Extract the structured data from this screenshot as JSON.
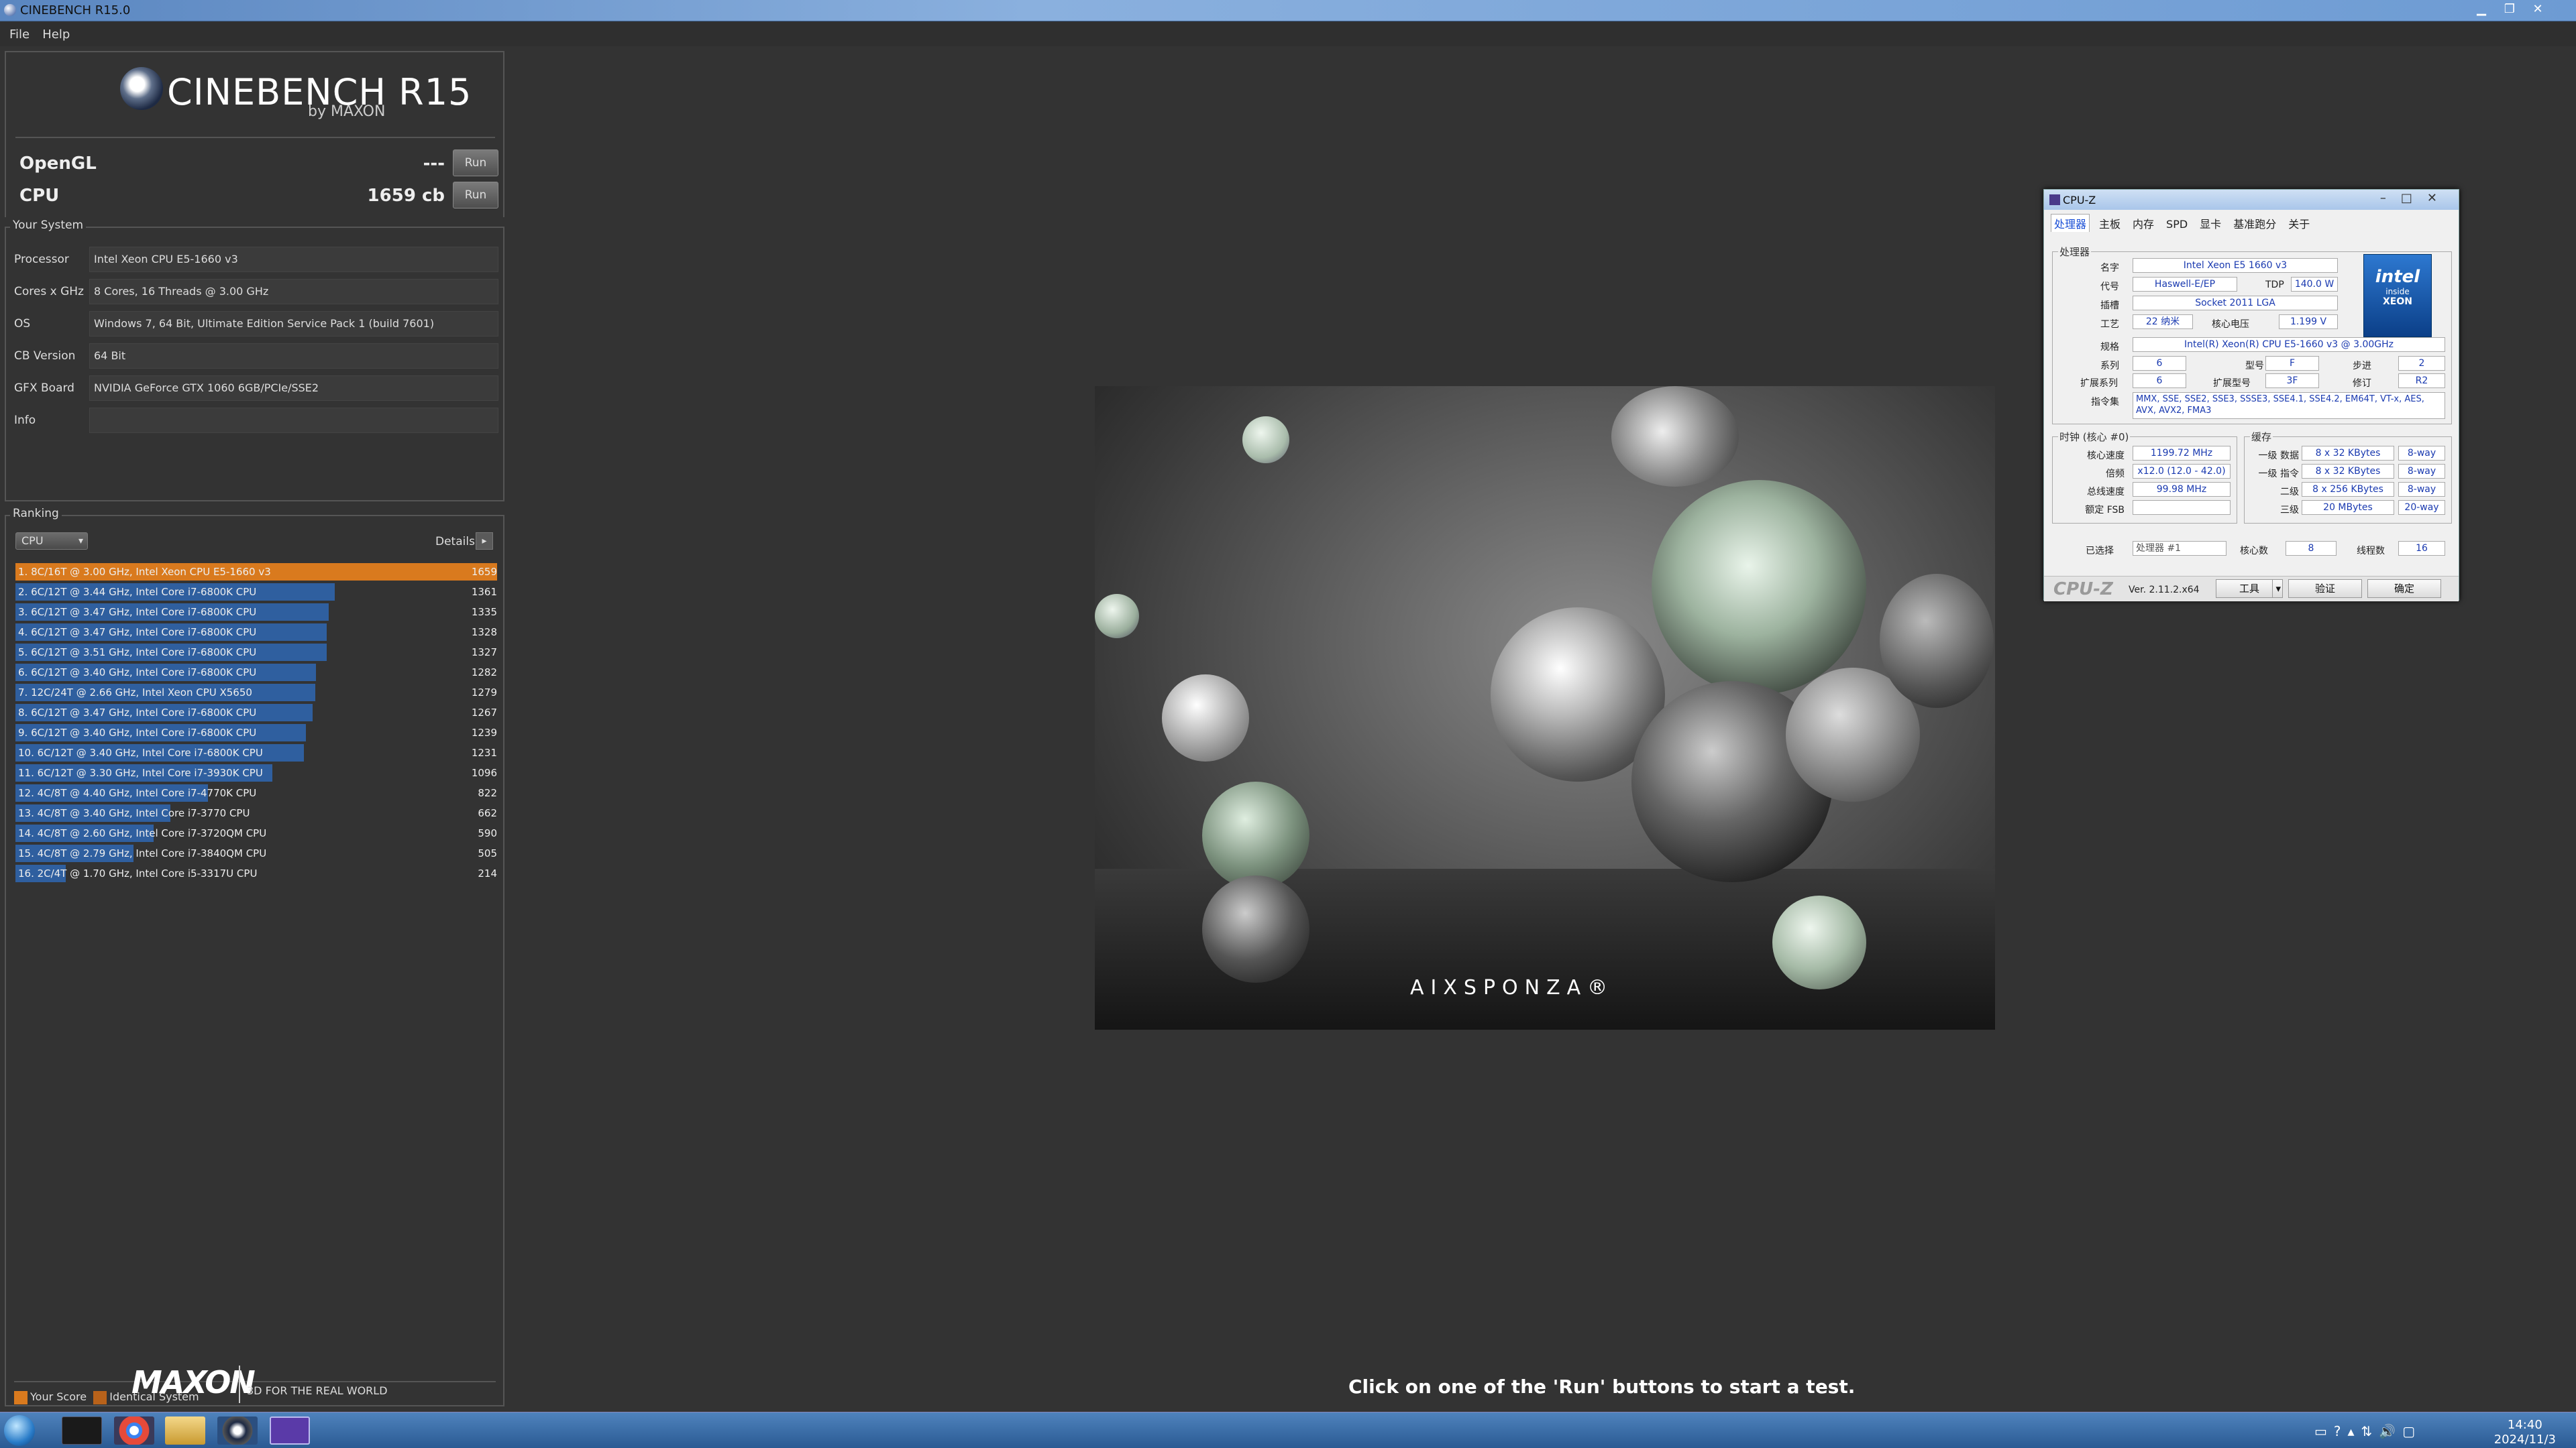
{
  "window": {
    "title": "CINEBENCH R15.0"
  },
  "menu": [
    "File",
    "Help"
  ],
  "logo": {
    "name": "CINEBENCH R15",
    "by": "by MAXON"
  },
  "tests": [
    {
      "label": "OpenGL",
      "value": "---",
      "run": "Run"
    },
    {
      "label": "CPU",
      "value": "1659 cb",
      "run": "Run"
    }
  ],
  "your_system": {
    "title": "Your System",
    "rows": [
      {
        "k": "Processor",
        "v": "Intel Xeon CPU E5-1660 v3"
      },
      {
        "k": "Cores x GHz",
        "v": "8 Cores, 16 Threads @ 3.00 GHz"
      },
      {
        "k": "OS",
        "v": "Windows 7, 64 Bit, Ultimate Edition Service Pack 1 (build 7601)"
      },
      {
        "k": "CB Version",
        "v": "64 Bit"
      },
      {
        "k": "GFX Board",
        "v": "NVIDIA GeForce GTX 1060 6GB/PCIe/SSE2"
      },
      {
        "k": "Info",
        "v": ""
      }
    ]
  },
  "ranking": {
    "title": "Ranking",
    "dropdown": "CPU",
    "details": "Details",
    "details_arrow": "▸",
    "rows": [
      {
        "t": "1. 8C/16T @ 3.00 GHz, Intel Xeon CPU E5-1660 v3",
        "s": "1659",
        "frac": 1.0,
        "mine": true
      },
      {
        "t": "2. 6C/12T @ 3.44 GHz, Intel Core i7-6800K CPU",
        "s": "1361",
        "frac": 0.82
      },
      {
        "t": "3. 6C/12T @ 3.47 GHz, Intel Core i7-6800K CPU",
        "s": "1335",
        "frac": 0.805
      },
      {
        "t": "4. 6C/12T @ 3.47 GHz, Intel Core i7-6800K CPU",
        "s": "1328",
        "frac": 0.8
      },
      {
        "t": "5. 6C/12T @ 3.51 GHz, Intel Core i7-6800K CPU",
        "s": "1327",
        "frac": 0.8
      },
      {
        "t": "6. 6C/12T @ 3.40 GHz, Intel Core i7-6800K CPU",
        "s": "1282",
        "frac": 0.773
      },
      {
        "t": "7. 12C/24T @ 2.66 GHz, Intel Xeon CPU X5650",
        "s": "1279",
        "frac": 0.771
      },
      {
        "t": "8. 6C/12T @ 3.47 GHz, Intel Core i7-6800K CPU",
        "s": "1267",
        "frac": 0.764
      },
      {
        "t": "9. 6C/12T @ 3.40 GHz, Intel Core i7-6800K CPU",
        "s": "1239",
        "frac": 0.747
      },
      {
        "t": "10. 6C/12T @ 3.40 GHz, Intel Core i7-6800K CPU",
        "s": "1231",
        "frac": 0.742
      },
      {
        "t": "11. 6C/12T @ 3.30 GHz,  Intel Core i7-3930K CPU",
        "s": "1096",
        "frac": 0.661
      },
      {
        "t": "12. 4C/8T @ 4.40 GHz, Intel Core i7-4770K CPU",
        "s": "822",
        "frac": 0.495
      },
      {
        "t": "13. 4C/8T @ 3.40 GHz,  Intel Core i7-3770 CPU",
        "s": "662",
        "frac": 0.399
      },
      {
        "t": "14. 4C/8T @ 2.60 GHz, Intel Core i7-3720QM CPU",
        "s": "590",
        "frac": 0.356
      },
      {
        "t": "15. 4C/8T @ 2.79 GHz,  Intel Core i7-3840QM CPU",
        "s": "505",
        "frac": 0.304
      },
      {
        "t": "16. 2C/4T @ 1.70 GHz,  Intel Core i5-3317U CPU",
        "s": "214",
        "frac": 0.129
      }
    ],
    "legend": {
      "yours": "Your Score",
      "identical": "Identical System",
      "yours_color": "#d97a1e",
      "identical_color": "#b8621a"
    }
  },
  "footer": {
    "maxon": "MAXON",
    "tagline": "3D FOR THE REAL WORLD",
    "hint": "Click on one of the 'Run' buttons to start a test."
  },
  "render": {
    "watermark": "AIXSPONZA®"
  },
  "cpuz": {
    "title": "CPU-Z",
    "tabs": [
      "处理器",
      "主板",
      "内存",
      "SPD",
      "显卡",
      "基准跑分",
      "关于"
    ],
    "proc_group": "处理器",
    "labels": {
      "name": "名字",
      "code": "代号",
      "tdp": "TDP",
      "pkg": "插槽",
      "tech": "工艺",
      "vcore": "核心电压",
      "spec": "规格",
      "family": "系列",
      "model": "型号",
      "stepping": "步进",
      "extfam": "扩展系列",
      "extmodel": "扩展型号",
      "rev": "修订",
      "instr": "指令集"
    },
    "name": "Intel Xeon E5 1660 v3",
    "code": "Haswell-E/EP",
    "tdp": "140.0 W",
    "pkg": "Socket 2011 LGA",
    "tech": "22 纳米",
    "vcore": "1.199 V",
    "spec": "Intel(R) Xeon(R) CPU E5-1660 v3 @ 3.00GHz",
    "family": "6",
    "model": "F",
    "stepping": "2",
    "extfam": "6",
    "extmodel": "3F",
    "rev": "R2",
    "instr": "MMX, SSE, SSE2, SSE3, SSSE3, SSE4.1, SSE4.2, EM64T, VT-x, AES, AVX, AVX2, FMA3",
    "intel": {
      "a": "intel",
      "b": "inside",
      "c": "XEON"
    },
    "clock_group": "时钟 (核心 #0)",
    "cache_group": "缓存",
    "clock": [
      {
        "k": "核心速度",
        "v": "1199.72 MHz"
      },
      {
        "k": "倍频",
        "v": "x12.0 (12.0 - 42.0)"
      },
      {
        "k": "总线速度",
        "v": "99.98 MHz"
      },
      {
        "k": "额定 FSB",
        "v": ""
      }
    ],
    "cache": [
      {
        "k": "一级 数据",
        "v": "8 x 32 KBytes",
        "w": "8-way"
      },
      {
        "k": "一级 指令",
        "v": "8 x 32 KBytes",
        "w": "8-way"
      },
      {
        "k": "二级",
        "v": "8 x 256 KBytes",
        "w": "8-way"
      },
      {
        "k": "三级",
        "v": "20 MBytes",
        "w": "20-way"
      }
    ],
    "sel_label": "已选择",
    "sel": "处理器 #1",
    "cores_label": "核心数",
    "cores": "8",
    "threads_label": "线程数",
    "threads": "16",
    "logo": "CPU-Z",
    "ver": "Ver. 2.11.2.x64",
    "tools": "工具",
    "validate": "验证",
    "ok": "确定"
  },
  "taskbar": {
    "time": "14:40",
    "date": "2024/11/3"
  }
}
